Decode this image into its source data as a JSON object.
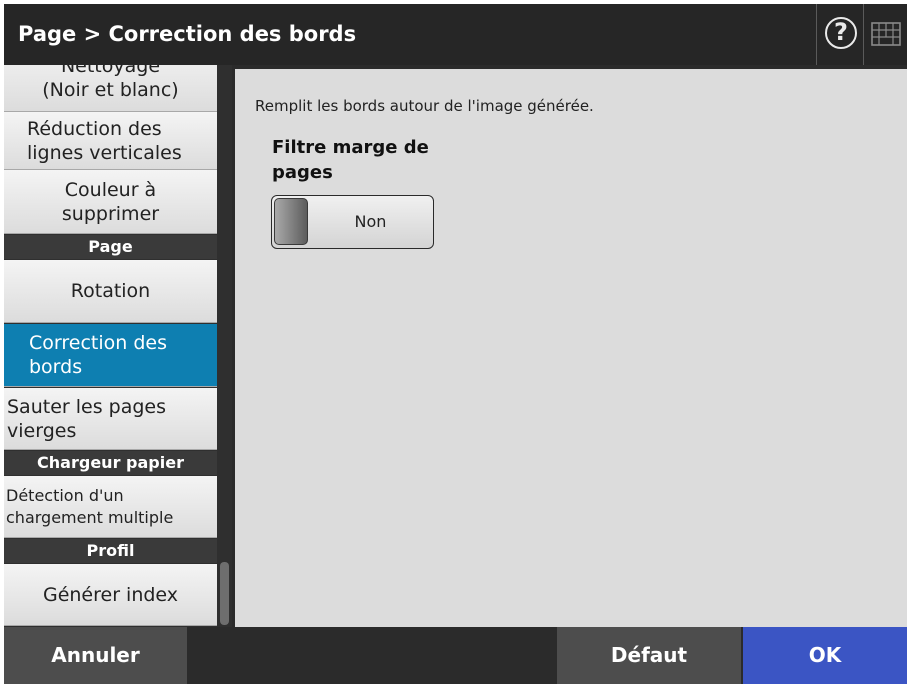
{
  "header": {
    "title": "Page > Correction des bords",
    "help_glyph": "?",
    "icons": [
      "help-icon",
      "keyboard-icon"
    ]
  },
  "sidebar": {
    "items": [
      {
        "label": "Nettoyage\n(Noir et blanc)",
        "type": "item"
      },
      {
        "label": "Réduction des\nlignes verticales",
        "type": "item"
      },
      {
        "label": "Couleur à\nsupprimer",
        "type": "item"
      },
      {
        "label": "Page",
        "type": "category"
      },
      {
        "label": "Rotation",
        "type": "item"
      },
      {
        "label": "Correction des\nbords",
        "type": "item",
        "selected": true
      },
      {
        "label": "Sauter les pages\nvierges",
        "type": "item"
      },
      {
        "label": "Chargeur papier",
        "type": "category"
      },
      {
        "label": "Détection d'un\nchargement multiple",
        "type": "item"
      },
      {
        "label": "Profil",
        "type": "category"
      },
      {
        "label": "Générer index",
        "type": "item"
      }
    ]
  },
  "main": {
    "description": "Remplit les bords autour de l'image générée.",
    "setting_label": "Filtre marge de pages",
    "toggle_value": "Non"
  },
  "footer": {
    "cancel_label": "Annuler",
    "default_label": "Défaut",
    "ok_label": "OK"
  },
  "colors": {
    "header_bg": "#262626",
    "selected_item": "#0e7fb1",
    "ok_button": "#3b55c4",
    "footer_button": "#4d4d4d",
    "panel_bg": "#dcdcdc"
  }
}
